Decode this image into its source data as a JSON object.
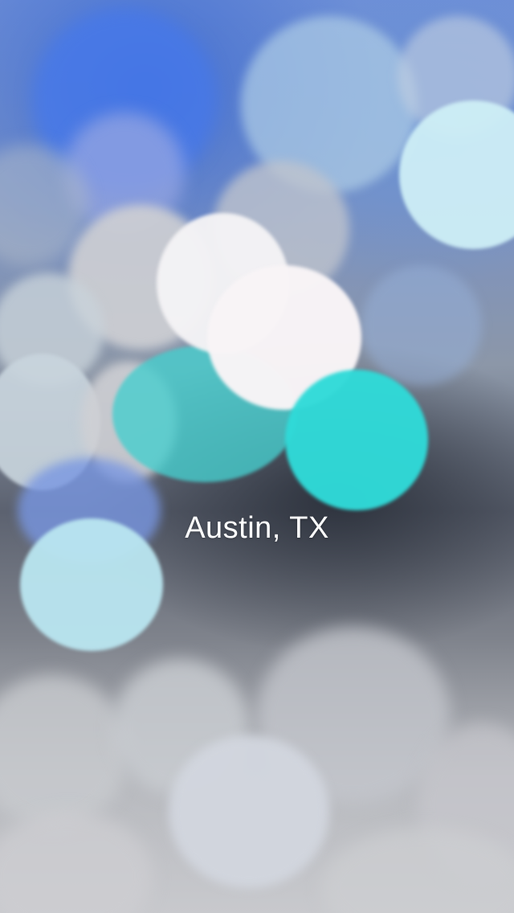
{
  "overlay": {
    "location_label": "Austin, TX"
  },
  "background": {
    "description_icon": "bokeh-lights-background",
    "palette": {
      "blue": "#4a7be0",
      "cyan": "#35d9d6",
      "white": "#f4f2f3",
      "gray": "#c8cbd0"
    }
  }
}
